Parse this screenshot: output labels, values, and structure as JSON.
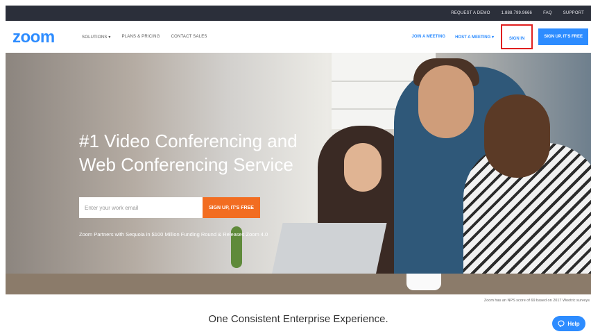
{
  "topbar": {
    "links": [
      "REQUEST A DEMO",
      "1.888.799.9666",
      "FAQ",
      "SUPPORT"
    ]
  },
  "nav": {
    "logo": "zoom",
    "menu": [
      "SOLUTIONS ▾",
      "PLANS & PRICING",
      "CONTACT SALES"
    ],
    "join": "JOIN A MEETING",
    "host": "HOST A MEETING ▾",
    "signin": "SIGN IN",
    "signup": "SIGN UP, IT'S FREE"
  },
  "hero": {
    "headline_1": "#1 Video Conferencing and",
    "headline_2": "Web Conferencing Service",
    "email_placeholder": "Enter your work email",
    "signup": "SIGN UP, IT'S FREE",
    "partners": "Zoom Partners with Sequoia in $100 Million Funding Round & Releases Zoom 4.0"
  },
  "nps_note": "Zoom has an NPS score of 69 based on 2017 Wootric surveys",
  "tagline": "One Consistent Enterprise Experience.",
  "help_label": "Help",
  "colors": {
    "brand": "#2d8cff",
    "cta_orange": "#f26d21",
    "highlight": "#e01f1f",
    "topbar": "#2b2f3a"
  },
  "icons": [
    "chat-bubble-icon"
  ]
}
